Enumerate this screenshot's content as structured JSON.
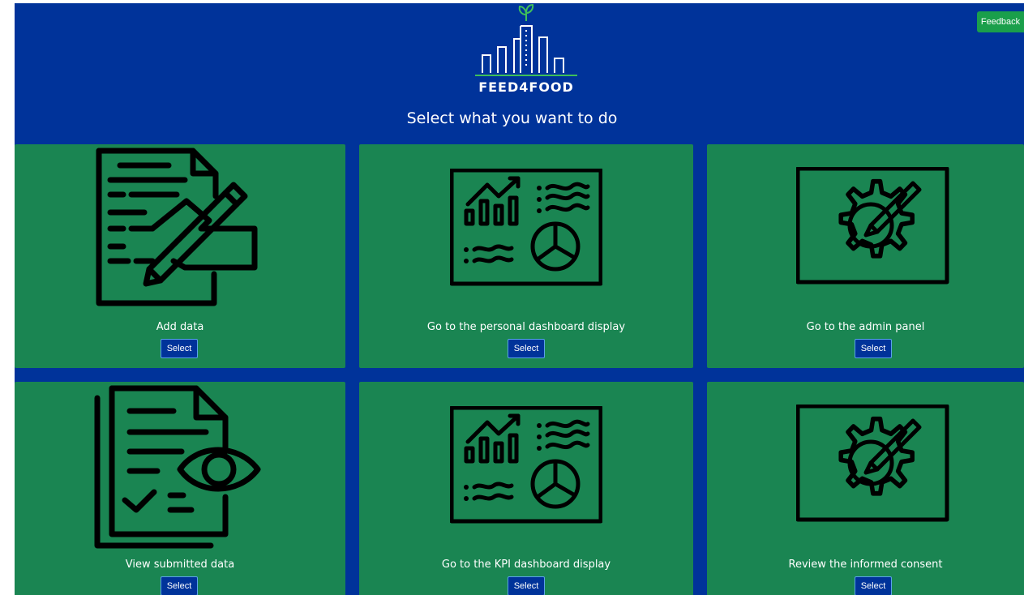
{
  "header": {
    "logo_text": "FEED4FOOD",
    "title": "Select what you want to do",
    "feedback_label": "Feedback"
  },
  "cards": [
    {
      "label": "Add data",
      "button": "Select",
      "icon": "document-pen-icon"
    },
    {
      "label": "Go to the personal dashboard display",
      "button": "Select",
      "icon": "dashboard-icon"
    },
    {
      "label": "Go to the admin panel",
      "button": "Select",
      "icon": "gear-pen-icon"
    },
    {
      "label": "View submitted data",
      "button": "Select",
      "icon": "document-eye-icon"
    },
    {
      "label": "Go to the KPI dashboard display",
      "button": "Select",
      "icon": "dashboard-icon"
    },
    {
      "label": "Review the informed consent",
      "button": "Select",
      "icon": "gear-pen-icon"
    }
  ],
  "colors": {
    "header_bg": "#00339a",
    "card_bg": "#1a8552",
    "feedback_bg": "#1a9f4b",
    "button_bg": "#00339a"
  }
}
